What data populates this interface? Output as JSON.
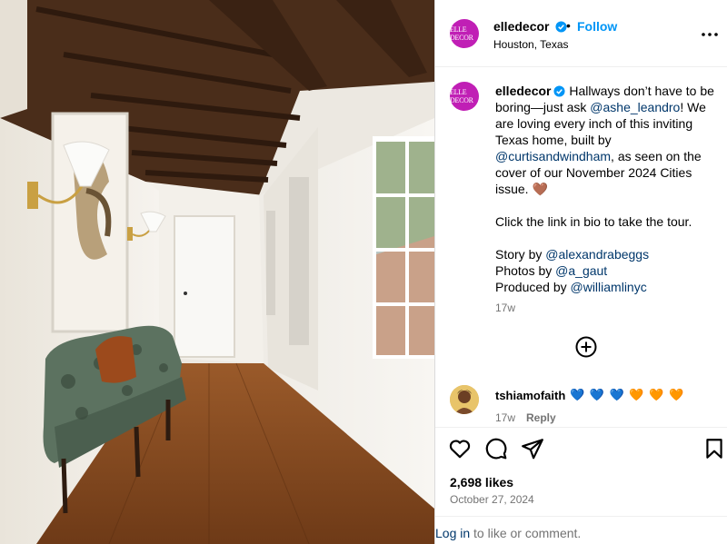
{
  "post": {
    "image_alt": "Hallway interior photo",
    "header": {
      "avatar_text": "ELLE DECOR",
      "username": "elledecor",
      "separator": "•",
      "follow_label": "Follow",
      "location": "Houston, Texas",
      "more_icon": "more-options-icon"
    },
    "caption": {
      "avatar_text": "ELLE DECOR",
      "username": "elledecor",
      "p1_before": " Hallways don’t have to be boring—just ask ",
      "mention_1": "@ashe_leandro",
      "p1_mid": "! We are loving every inch of this inviting Texas home, built by ",
      "mention_2": "@curtisandwindham",
      "p1_after": ", as seen on the cover of our November 2024 Cities issue. ",
      "heart": "🤎",
      "p2": "Click the link in bio to take the tour.",
      "credit_story_label": "Story by ",
      "credit_story_mention": "@alexandrabeggs",
      "credit_photos_label": "Photos by ",
      "credit_photos_mention": "@a_gaut",
      "credit_produced_label": "Produced by ",
      "credit_produced_mention": "@williamlinyc",
      "time": "17w"
    },
    "comment": {
      "username": "tshiamofaith",
      "emoji_blue": "💙 💙 💙",
      "emoji_orange": "🧡 🧡 🧡",
      "time": "17w",
      "reply_label": "Reply"
    },
    "stats": {
      "likes": "2,698 likes",
      "date": "October 27, 2024"
    },
    "footer": {
      "login_link": "Log in",
      "login_text": " to like or comment."
    },
    "colors": {
      "accent": "#0095f6",
      "brand": "#c01fb5",
      "mention": "#00376b",
      "muted": "#737373"
    }
  }
}
